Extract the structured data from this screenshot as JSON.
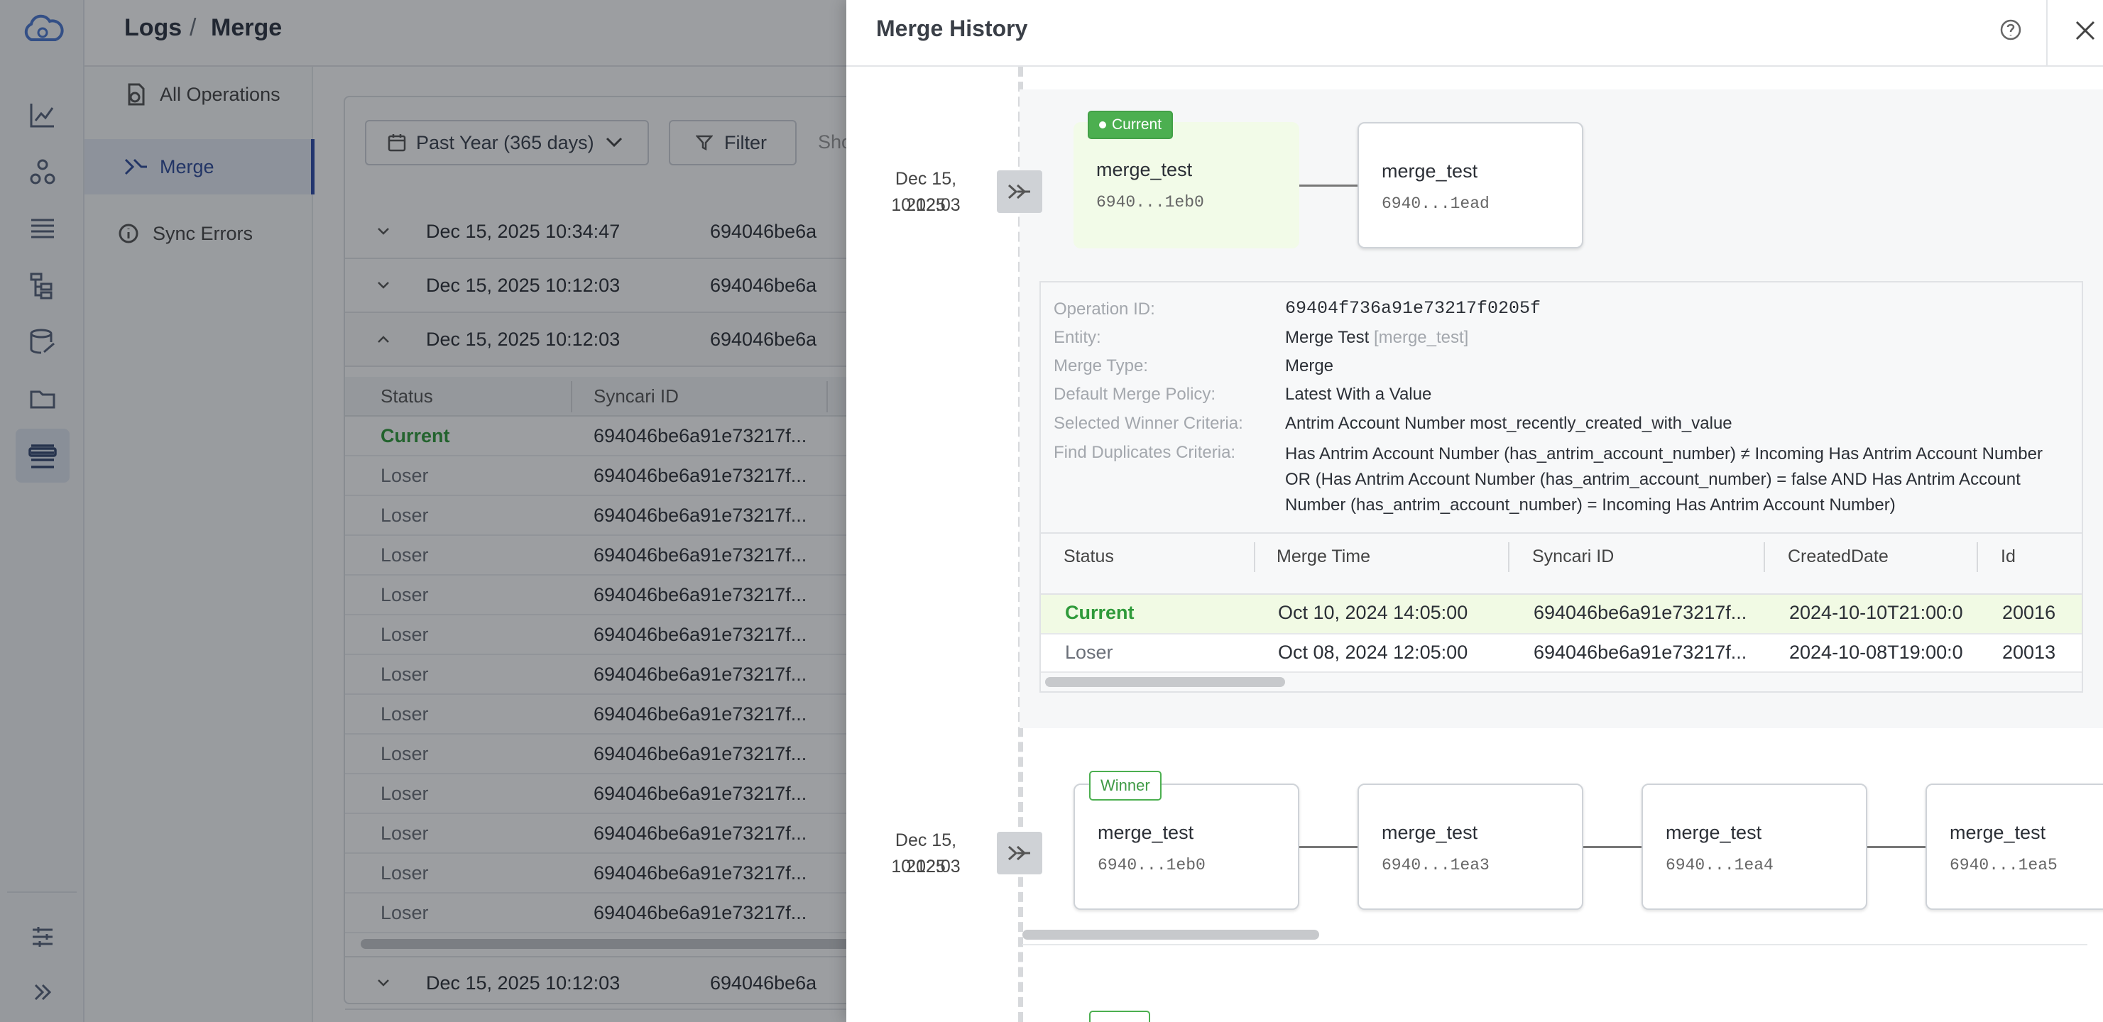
{
  "breadcrumb": {
    "root": "Logs",
    "separator": "/",
    "current": "Merge"
  },
  "subnav": {
    "items": [
      {
        "label": "All Operations",
        "icon": "operations-icon"
      },
      {
        "label": "Merge",
        "icon": "merge-icon"
      },
      {
        "label": "Sync Errors",
        "icon": "info-icon"
      }
    ]
  },
  "toolbar": {
    "date_range": "Past Year (365 days)",
    "filter_label": "Filter",
    "show_label": "Sho"
  },
  "groups": [
    {
      "datetime": "Dec 15, 2025 10:34:47",
      "id": "694046be6a"
    },
    {
      "datetime": "Dec 15, 2025 10:12:03",
      "id": "694046be6a"
    },
    {
      "datetime": "Dec 15, 2025 10:12:03",
      "id": "694046be6a"
    },
    {
      "datetime": "Dec 15, 2025 10:12:03",
      "id": "694046be6a"
    }
  ],
  "subtable": {
    "headers": [
      "Status",
      "Syncari ID"
    ],
    "rows": [
      {
        "status": "Current",
        "syncari_id": "694046be6a91e73217f..."
      },
      {
        "status": "Loser",
        "syncari_id": "694046be6a91e73217f..."
      },
      {
        "status": "Loser",
        "syncari_id": "694046be6a91e73217f..."
      },
      {
        "status": "Loser",
        "syncari_id": "694046be6a91e73217f..."
      },
      {
        "status": "Loser",
        "syncari_id": "694046be6a91e73217f..."
      },
      {
        "status": "Loser",
        "syncari_id": "694046be6a91e73217f..."
      },
      {
        "status": "Loser",
        "syncari_id": "694046be6a91e73217f..."
      },
      {
        "status": "Loser",
        "syncari_id": "694046be6a91e73217f..."
      },
      {
        "status": "Loser",
        "syncari_id": "694046be6a91e73217f..."
      },
      {
        "status": "Loser",
        "syncari_id": "694046be6a91e73217f..."
      },
      {
        "status": "Loser",
        "syncari_id": "694046be6a91e73217f..."
      },
      {
        "status": "Loser",
        "syncari_id": "694046be6a91e73217f..."
      },
      {
        "status": "Loser",
        "syncari_id": "694046be6a91e73217f..."
      }
    ]
  },
  "drawer": {
    "title": "Merge History",
    "entry1": {
      "date": "Dec 15, 2025",
      "time": "10:12:03",
      "badge": "Current",
      "cards": [
        {
          "name": "merge_test",
          "id": "6940...1eb0"
        },
        {
          "name": "merge_test",
          "id": "6940...1ead"
        }
      ],
      "details": [
        {
          "label": "Operation ID:",
          "value": "69404f736a91e73217f0205f"
        },
        {
          "label": "Entity:",
          "value": "Merge Test",
          "extra": "[merge_test]"
        },
        {
          "label": "Merge Type:",
          "value": "Merge"
        },
        {
          "label": "Default Merge Policy:",
          "value": "Latest With a Value"
        },
        {
          "label": "Selected Winner Criteria:",
          "value": "Antrim Account Number most_recently_created_with_value"
        },
        {
          "label": "Find Duplicates Criteria:",
          "value": "Has Antrim Account Number (has_antrim_account_number) ≠ Incoming Has Antrim Account Number OR (Has Antrim Account Number (has_antrim_account_number) = false AND Has Antrim Account Number (has_antrim_account_number) = Incoming Has Antrim Account Number)"
        }
      ],
      "table": {
        "headers": [
          "Status",
          "Merge Time",
          "Syncari ID",
          "CreatedDate",
          "Id"
        ],
        "rows": [
          [
            "Current",
            "Oct 10, 2024 14:05:00",
            "694046be6a91e73217f...",
            "2024-10-10T21:00:0",
            "20016"
          ],
          [
            "Loser",
            "Oct 08, 2024 12:05:00",
            "694046be6a91e73217f...",
            "2024-10-08T19:00:0",
            "20013"
          ]
        ]
      }
    },
    "entry2": {
      "date": "Dec 15, 2025",
      "time": "10:12:03",
      "badge": "Winner",
      "cards": [
        {
          "name": "merge_test",
          "id": "6940...1eb0"
        },
        {
          "name": "merge_test",
          "id": "6940...1ea3"
        },
        {
          "name": "merge_test",
          "id": "6940...1ea4"
        },
        {
          "name": "merge_test",
          "id": "6940...1ea5"
        }
      ]
    }
  },
  "colors": {
    "accent": "#2e4aa8",
    "current_green": "#2f9a3a",
    "badge_green": "#4caf50",
    "current_bg": "#f2fbe8"
  }
}
